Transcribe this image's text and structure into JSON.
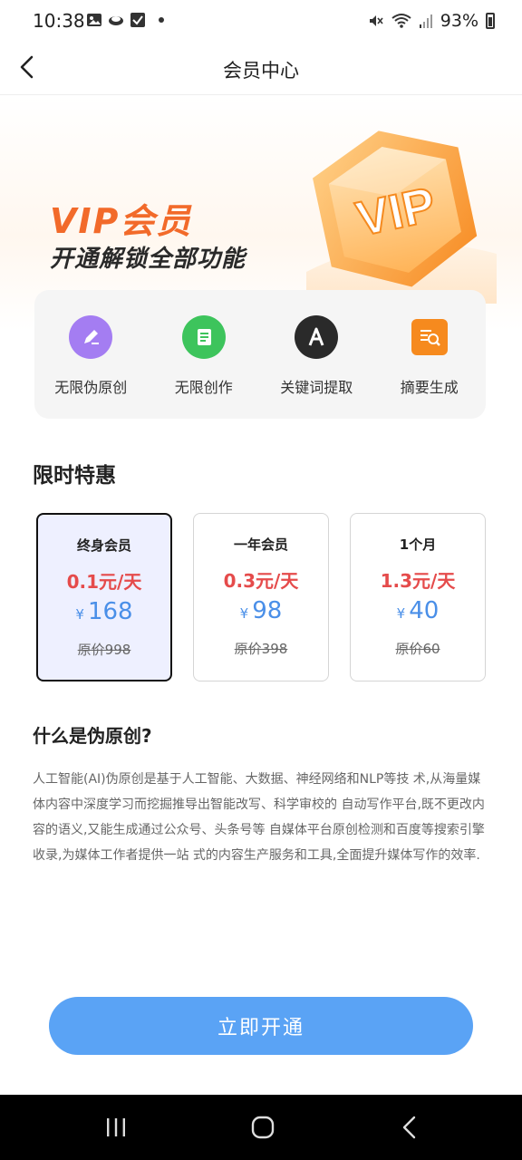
{
  "status_bar": {
    "time": "10:38",
    "battery": "93%"
  },
  "header": {
    "title": "会员中心"
  },
  "banner": {
    "title": "VIP会员",
    "subtitle": "开通解锁全部功能",
    "badge_text": "VIP"
  },
  "features": [
    {
      "label": "无限伪原创",
      "icon": "edit-icon",
      "color": "#a47df2"
    },
    {
      "label": "无限创作",
      "icon": "document-icon",
      "color": "#3dc45c"
    },
    {
      "label": "关键词提取",
      "icon": "letter-a-icon",
      "color": "#2a2a2a"
    },
    {
      "label": "摘要生成",
      "icon": "summary-search-icon",
      "color": "#f68a1e"
    }
  ],
  "offers": {
    "title": "限时特惠",
    "plans": [
      {
        "name": "终身会员",
        "daily": "0.1元/天",
        "currency": "¥",
        "price": "168",
        "original": "原价998",
        "selected": true
      },
      {
        "name": "一年会员",
        "daily": "0.3元/天",
        "currency": "¥",
        "price": "98",
        "original": "原价398",
        "selected": false
      },
      {
        "name": "1个月",
        "daily": "1.3元/天",
        "currency": "¥",
        "price": "40",
        "original": "原价60",
        "selected": false
      }
    ]
  },
  "description": {
    "title": "什么是伪原创?",
    "text": "人工智能(AI)伪原创是基于人工智能、大数据、神经网络和NLP等技 术,从海量媒体内容中深度学习而挖掘推导出智能改写、科学审校的 自动写作平台,既不更改内容的语义,又能生成通过公众号、头条号等 自媒体平台原创检测和百度等搜索引擎收录,为媒体工作者提供一站 式的内容生产服务和工具,全面提升媒体写作的效率."
  },
  "cta": {
    "label": "立即开通"
  },
  "colors": {
    "accent_blue": "#5aa3f5",
    "price_blue": "#4a8fe8",
    "daily_red": "#e54b4b",
    "vip_orange": "#f26a2a"
  }
}
